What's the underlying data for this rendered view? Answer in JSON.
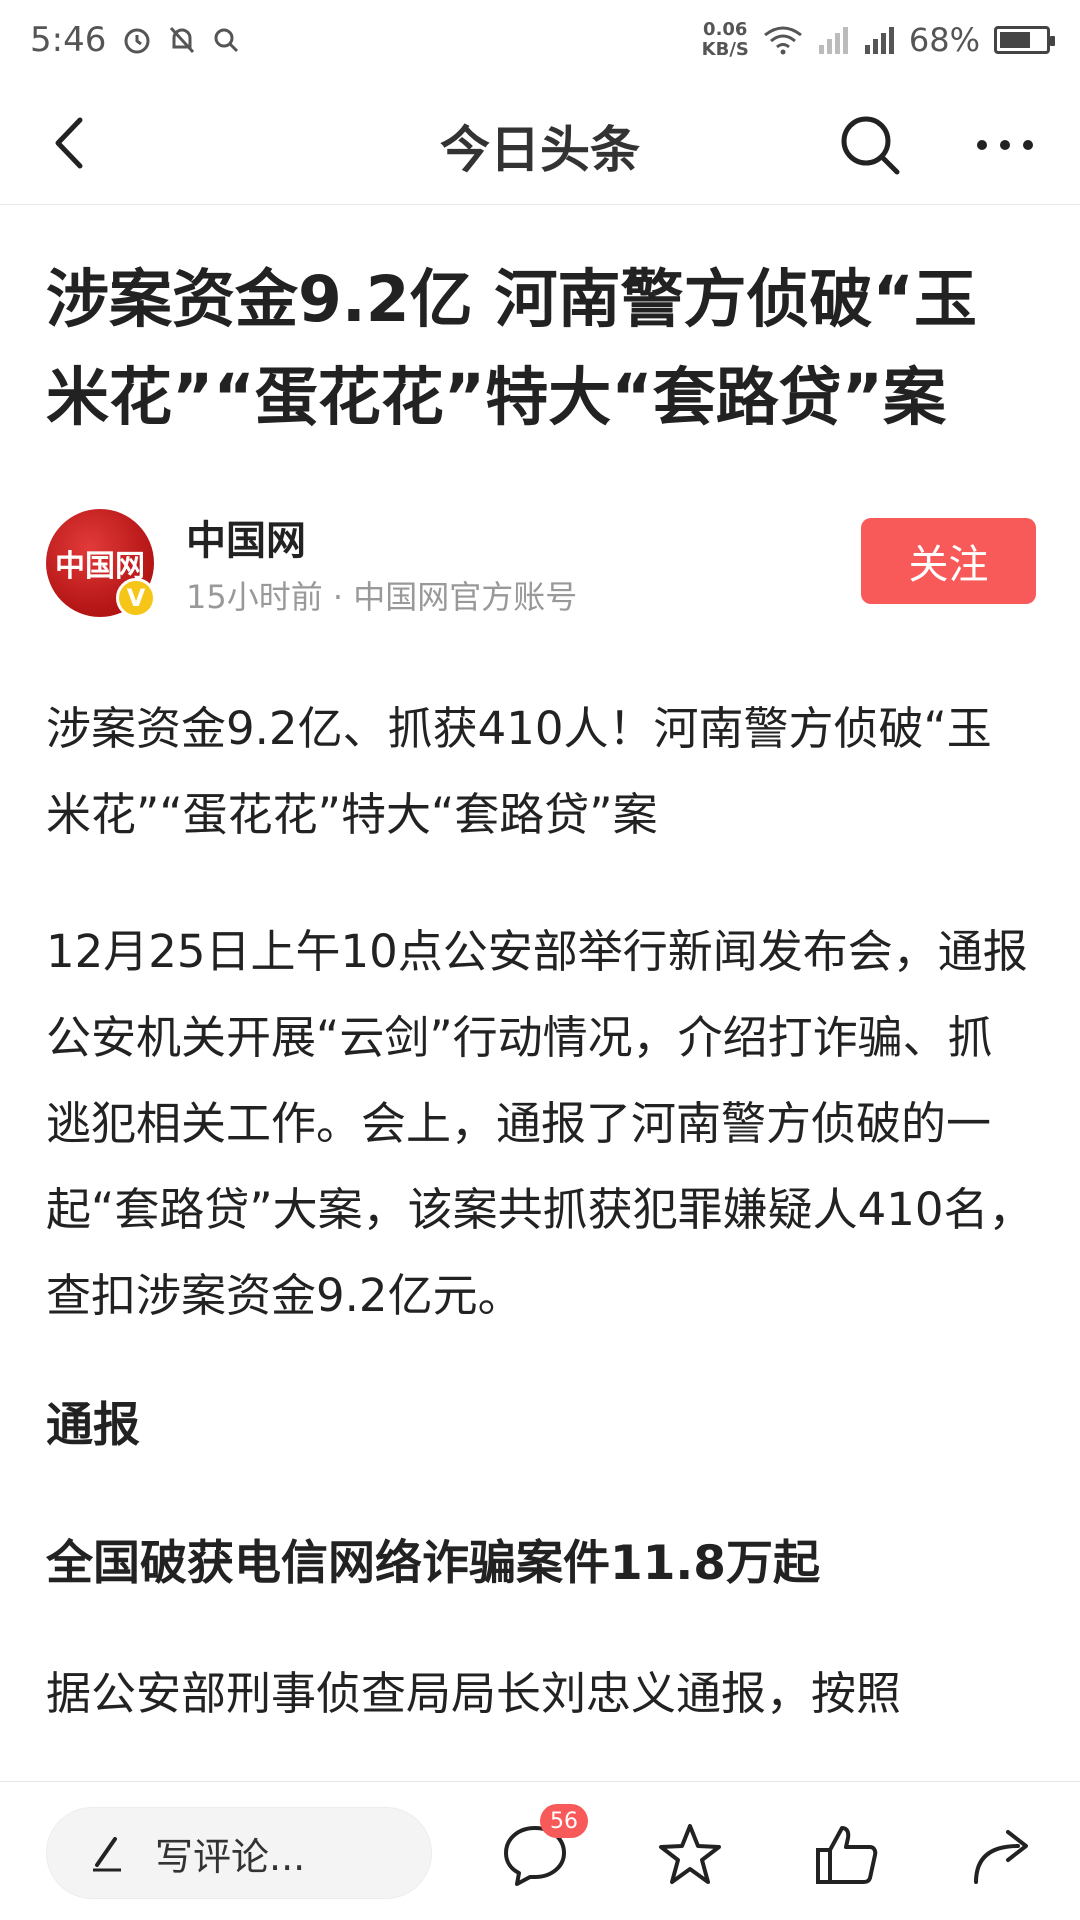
{
  "status_bar": {
    "time": "5:46",
    "net_speed_value": "0.06",
    "net_speed_unit": "KB/S",
    "battery": "68%",
    "battery_level": 0.68,
    "icons": [
      "alarm-icon",
      "mute-icon",
      "search-icon",
      "wifi-icon",
      "signal-icon",
      "signal-icon",
      "battery-icon"
    ]
  },
  "nav": {
    "title": "今日头条",
    "icons": [
      "back-icon",
      "search-icon",
      "more-icon"
    ]
  },
  "article": {
    "headline": "涉案资金9.2亿 河南警方侦破“玉米花”“蛋花花”特大“套路贷”案",
    "author": {
      "avatar_text": "中国网",
      "verified_mark": "V",
      "name": "中国网",
      "meta": "15小时前 · 中国网官方账号",
      "follow_label": "关注"
    },
    "paragraph_1": "涉案资金9.2亿、抓获410人！河南警方侦破“玉米花”“蛋花花”特大“套路贷”案",
    "paragraph_2": "12月25日上午10点公安部举行新闻发布会，通报公安机关开展“云剑”行动情况，介绍打诈骗、抓逃犯相关工作。会上，通报了河南警方侦破的一起“套路贷”大案，该案共抓获犯罪嫌疑人410名，查扣涉案资金9.2亿元。",
    "heading_1": "通报",
    "heading_2": "全国破获电信网络诈骗案件11.8万起",
    "paragraph_3": "据公安部刑事侦查局局长刘忠义通报，按照"
  },
  "bottom_bar": {
    "comment_placeholder": "写评论...",
    "comment_count": "56",
    "icons": [
      "pen-icon",
      "comment-icon",
      "star-icon",
      "thumbs-up-icon",
      "share-icon"
    ]
  },
  "colors": {
    "accent": "#f85959",
    "text": "#222222",
    "meta": "#999999"
  }
}
